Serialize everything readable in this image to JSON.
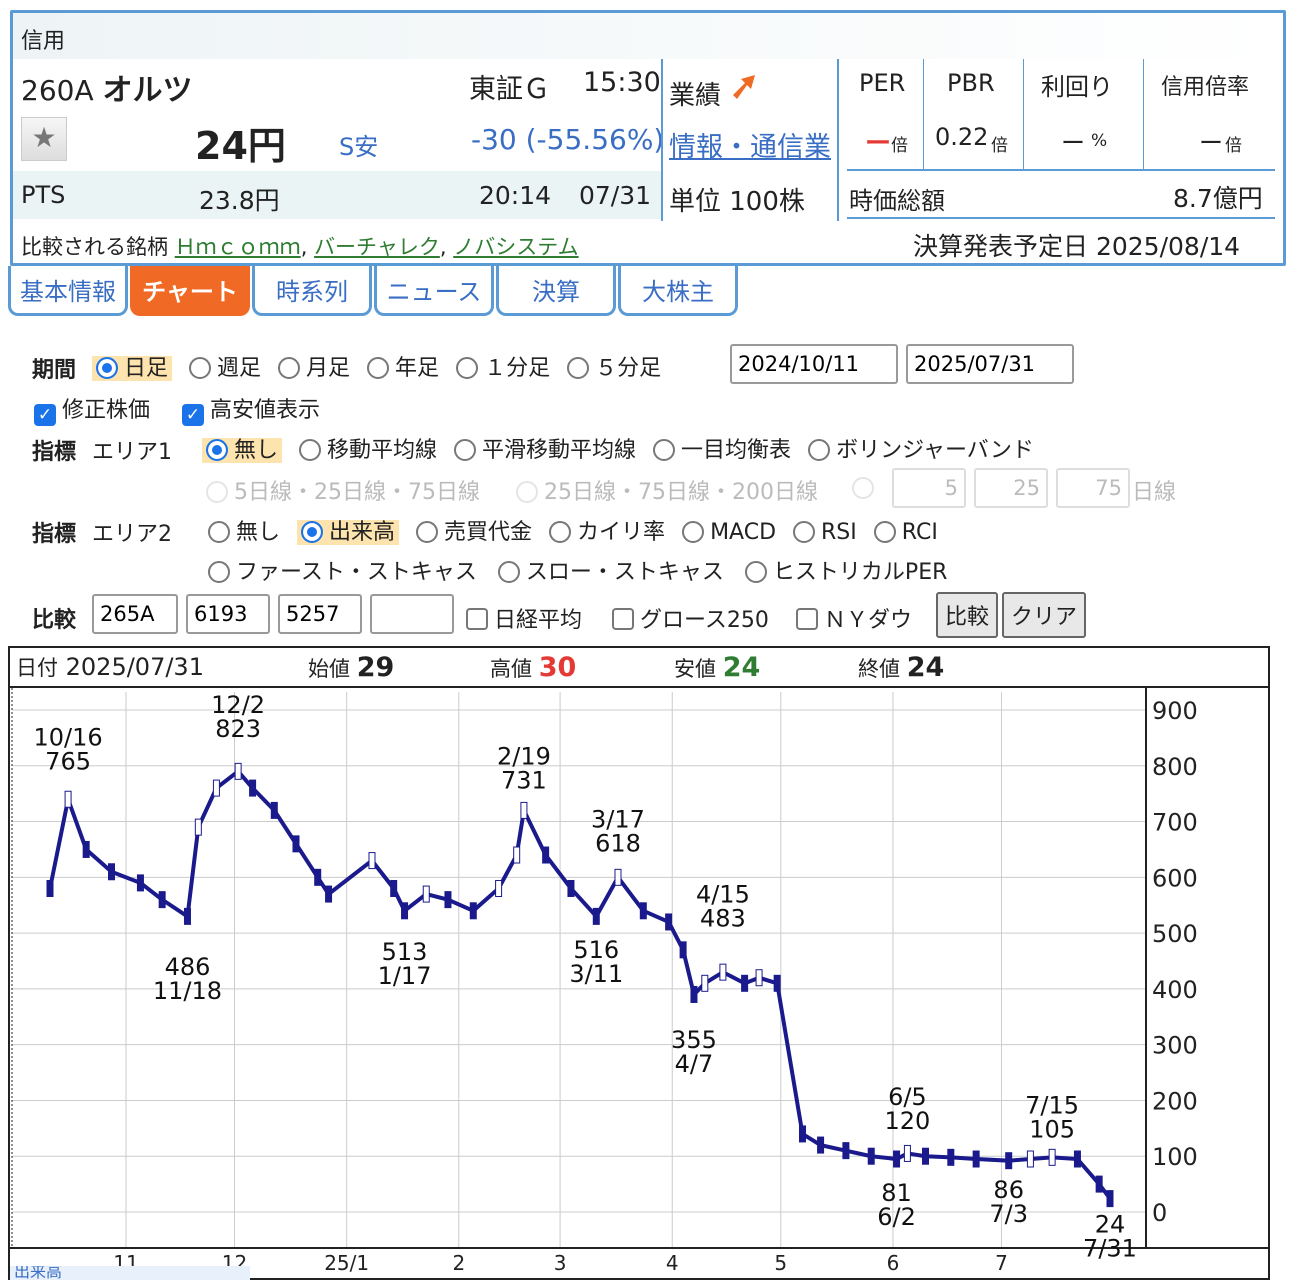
{
  "header": {
    "section": "信用",
    "code": "260A",
    "name": "オルツ",
    "market": "東証Ｇ",
    "time": "15:30",
    "price": "24円",
    "limit": "S安",
    "change": "-30 (-55.56%)",
    "pts_label": "PTS",
    "pts_price": "23.8円",
    "pts_time": "20:14",
    "pts_date": "07/31",
    "performance_label": "業績",
    "industry": "情報・通信業",
    "unit": "単位 100株",
    "per_label": "PER",
    "per_value": "ー",
    "per_unit": "倍",
    "pbr_label": "PBR",
    "pbr_value": "0.22",
    "pbr_unit": "倍",
    "yield_label": "利回り",
    "yield_value": "ー",
    "yield_unit": "%",
    "margin_label": "信用倍率",
    "margin_value": "ー",
    "margin_unit": "倍",
    "mcap_label": "時価総額",
    "mcap_value": "8.7億円",
    "compare_label": "比較される銘柄",
    "compare_1": "Ｈｍｃｏｍｍ",
    "compare_2": "バーチャレク",
    "compare_3": "ノバシステム",
    "sep": ",",
    "earnings_label": "決算発表予定日",
    "earnings_date": "2025/08/14"
  },
  "tabs": [
    "基本情報",
    "チャート",
    "時系列",
    "ニュース",
    "決算",
    "大株主"
  ],
  "form": {
    "period_label": "期間",
    "period_options": [
      "日足",
      "週足",
      "月足",
      "年足",
      "１分足",
      "５分足"
    ],
    "period_selected": "日足",
    "date_from": "2024/10/11",
    "date_to": "2025/07/31",
    "adjusted": "修正株価",
    "highlow": "高安値表示",
    "ind_label": "指標",
    "area1_label": "エリア1",
    "area1_options": [
      "無し",
      "移動平均線",
      "平滑移動平均線",
      "一目均衡表",
      "ボリンジャーバンド"
    ],
    "ma_opt1": "5日線・25日線・75日線",
    "ma_opt2": "25日線・75日線・200日線",
    "ma_in1": "5",
    "ma_in2": "25",
    "ma_in3": "75",
    "ma_suffix": "日線",
    "area2_label": "エリア2",
    "area2_options": [
      "無し",
      "出来高",
      "売買代金",
      "カイリ率",
      "MACD",
      "RSI",
      "RCI"
    ],
    "area2_options_b": [
      "ファースト・ストキャス",
      "スロー・ストキャス",
      "ヒストリカルPER"
    ],
    "compare_label": "比較",
    "cmp1": "265A",
    "cmp2": "6193",
    "cmp3": "5257",
    "cmp4": "",
    "nikkei": "日経平均",
    "growth": "グロース250",
    "ny": "ＮＹダウ",
    "compare_btn": "比較",
    "clear_btn": "クリア"
  },
  "ohlc": {
    "date_label": "日付",
    "date": "2025/07/31",
    "open_label": "始値",
    "open": "29",
    "high_label": "高値",
    "high": "30",
    "low_label": "安値",
    "low": "24",
    "close_label": "終値",
    "close": "24"
  },
  "colors": {
    "up": "#ffffff",
    "down": "#1a1a8c",
    "accent": "#f06a25",
    "link": "#3a6ec4",
    "high": "#e53935",
    "low": "#2e7d32"
  },
  "chart_data": {
    "type": "line",
    "title": "",
    "xlabel": "",
    "ylabel": "",
    "ylim": [
      0,
      900
    ],
    "y_ticks": [
      900,
      800,
      700,
      600,
      500,
      400,
      300,
      200,
      100,
      0
    ],
    "x_ticks": [
      "11",
      "12",
      "25/1",
      "2",
      "3",
      "4",
      "5",
      "6",
      "7"
    ],
    "grid": true,
    "series": [
      {
        "x": [
          "2024-10-11",
          "2024-10-16",
          "2024-10-21",
          "2024-10-28",
          "2024-11-05",
          "2024-11-11",
          "2024-11-18",
          "2024-11-21",
          "2024-11-26",
          "2024-12-02",
          "2024-12-06",
          "2024-12-12",
          "2024-12-18",
          "2024-12-24",
          "2024-12-27",
          "2025-01-08",
          "2025-01-14",
          "2025-01-17",
          "2025-01-23",
          "2025-01-29",
          "2025-02-05",
          "2025-02-12",
          "2025-02-17",
          "2025-02-19",
          "2025-02-25",
          "2025-03-04",
          "2025-03-11",
          "2025-03-17",
          "2025-03-24",
          "2025-03-31",
          "2025-04-04",
          "2025-04-07",
          "2025-04-10",
          "2025-04-15",
          "2025-04-21",
          "2025-04-25",
          "2025-04-30",
          "2025-05-07",
          "2025-05-12",
          "2025-05-19",
          "2025-05-26",
          "2025-06-02",
          "2025-06-05",
          "2025-06-10",
          "2025-06-17",
          "2025-06-24",
          "2025-07-03",
          "2025-07-09",
          "2025-07-15",
          "2025-07-22",
          "2025-07-28",
          "2025-07-31"
        ],
        "y": [
          580,
          740,
          650,
          610,
          590,
          560,
          530,
          690,
          760,
          790,
          760,
          720,
          660,
          600,
          570,
          630,
          580,
          540,
          570,
          560,
          540,
          580,
          640,
          720,
          640,
          580,
          530,
          600,
          540,
          520,
          470,
          390,
          410,
          430,
          410,
          420,
          410,
          140,
          120,
          110,
          100,
          95,
          105,
          100,
          98,
          95,
          92,
          95,
          98,
          95,
          50,
          24
        ]
      }
    ],
    "annotations": [
      {
        "date": "10/16",
        "value": 765
      },
      {
        "date": "12/2",
        "value": 823
      },
      {
        "date": "11/18",
        "value": 486
      },
      {
        "date": "1/17",
        "value": 513
      },
      {
        "date": "2/19",
        "value": 731
      },
      {
        "date": "3/17",
        "value": 618
      },
      {
        "date": "3/11",
        "value": 516
      },
      {
        "date": "4/15",
        "value": 483
      },
      {
        "date": "4/7",
        "value": 355
      },
      {
        "date": "6/5",
        "value": 120
      },
      {
        "date": "6/2",
        "value": 81
      },
      {
        "date": "7/15",
        "value": 105
      },
      {
        "date": "7/3",
        "value": 86
      },
      {
        "date": "7/31",
        "value": 24
      }
    ],
    "volume_label": "出来高"
  }
}
